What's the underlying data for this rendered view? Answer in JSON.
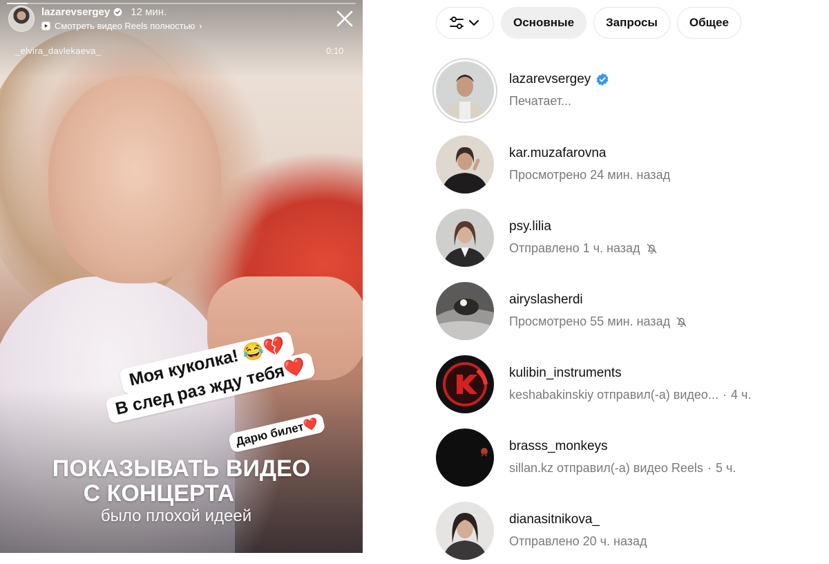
{
  "story": {
    "progress": 0.06,
    "username": "lazarevsergey",
    "verified": true,
    "time": "12 мин.",
    "reels_link": "Смотреть видео Reels полностью",
    "reels_chevron": "›",
    "credit": "_elvira_davlekaeva_",
    "duration": "0:10",
    "sticker1_text": "Моя куколка! ",
    "sticker1_emoji": "😂💔",
    "sticker2_text": "В след раз жду тебя",
    "sticker2_emoji": "❤️",
    "sticker3_text": "Дарю билет",
    "sticker3_emoji": "❤️",
    "caption_line1": "ПОКАЗЫВАТЬ ВИДЕО",
    "caption_line2": "С КОНЦЕРТА",
    "caption_line3": "было плохой идеей"
  },
  "filters": {
    "icon": "sliders-icon",
    "chevron": "chevron-down-icon",
    "tabs": [
      {
        "label": "Основные",
        "active": true
      },
      {
        "label": "Запросы",
        "active": false
      },
      {
        "label": "Общее",
        "active": false
      }
    ]
  },
  "threads": [
    {
      "name": "lazarevsergey",
      "verified": true,
      "status": "Печатает...",
      "muted": false
    },
    {
      "name": "kar.muzafarovna",
      "status": "Просмотрено 24 мин. назад",
      "muted": false
    },
    {
      "name": "psy.lilia",
      "status": "Отправлено 1 ч. назад",
      "muted": true
    },
    {
      "name": "airyslasherdi",
      "status": "Просмотрено 55 мин. назад",
      "muted": true
    },
    {
      "name": "kulibin_instruments",
      "status": "keshabakinskiy отправил(-а) видео...",
      "time": "4 ч."
    },
    {
      "name": "brasss_monkeys",
      "status": "sillan.kz отправил(-а) видео Reels",
      "time": "5 ч."
    },
    {
      "name": "dianasitnikova_",
      "status": "Отправлено 20 ч. назад",
      "muted": false
    }
  ],
  "colors": {
    "verified": "#3897f0",
    "muted_text": "#7a7a7a",
    "active_chip": "#efefef"
  }
}
